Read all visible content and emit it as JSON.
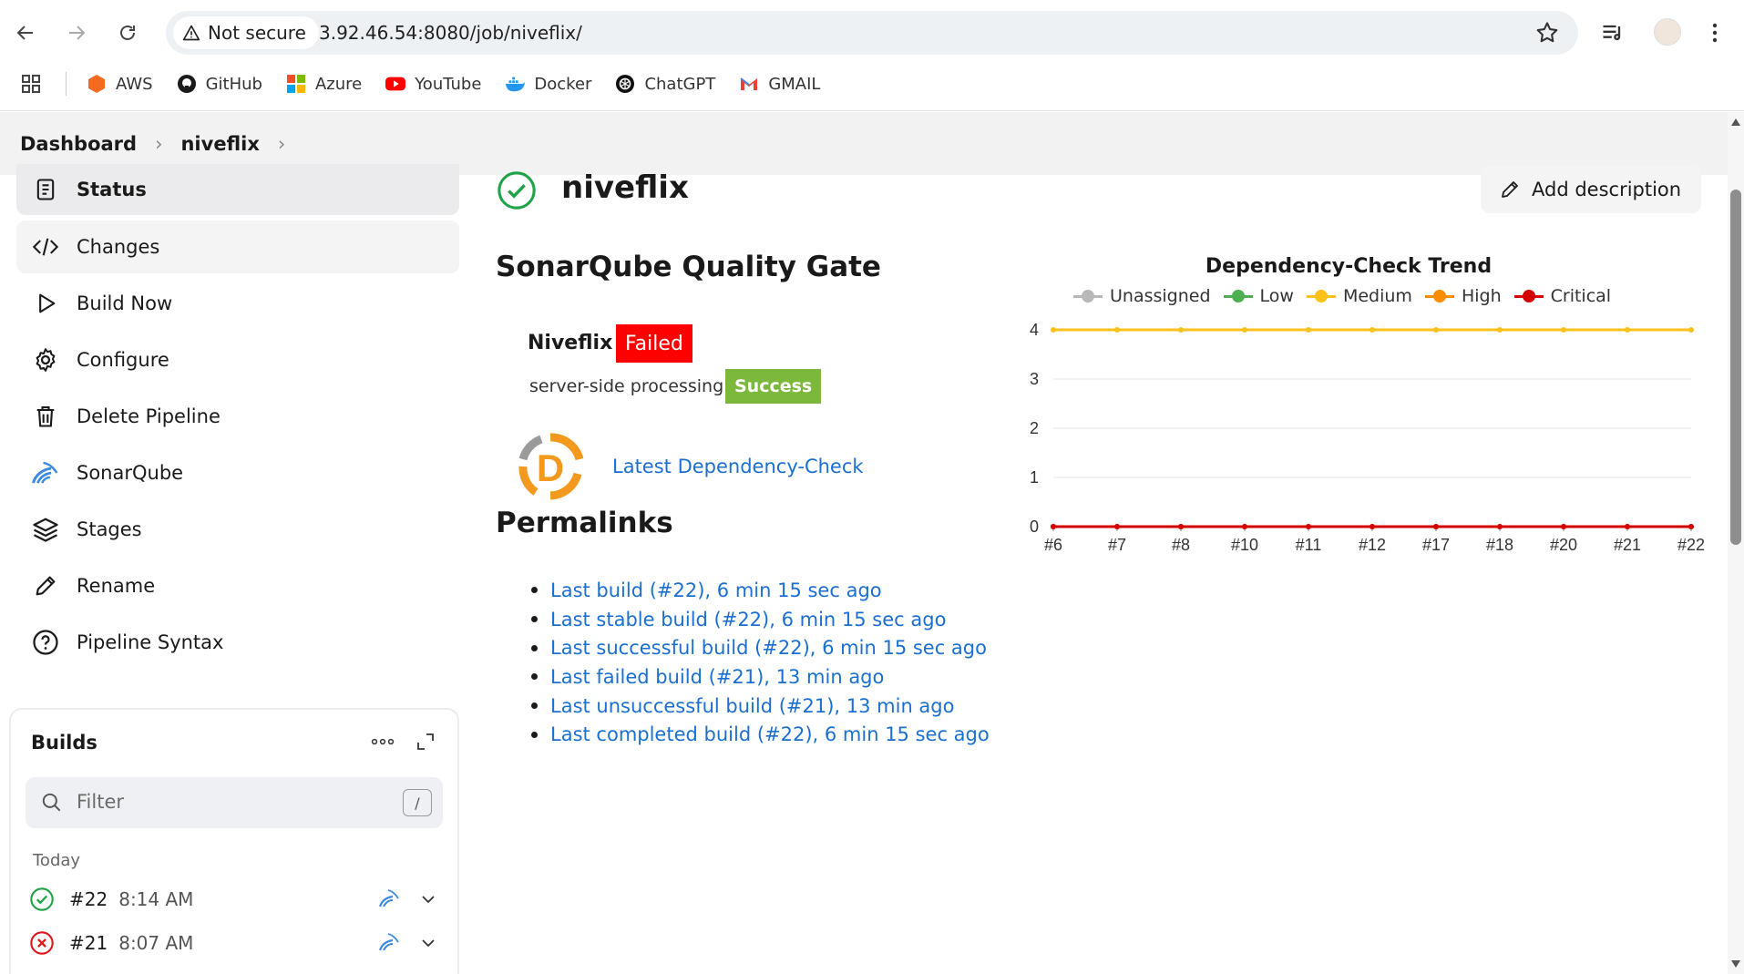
{
  "browser": {
    "security_label": "Not secure",
    "url": "3.92.46.54:8080/job/niveflix/",
    "bookmarks": [
      {
        "label": "AWS",
        "icon": "aws-icon",
        "color": "#f26b21"
      },
      {
        "label": "GitHub",
        "icon": "github-icon",
        "color": "#1a1a1a"
      },
      {
        "label": "Azure",
        "icon": "azure-icon",
        "color": "#0078d4"
      },
      {
        "label": "YouTube",
        "icon": "youtube-icon",
        "color": "#ff0000"
      },
      {
        "label": "Docker",
        "icon": "docker-icon",
        "color": "#2496ed"
      },
      {
        "label": "ChatGPT",
        "icon": "chatgpt-icon",
        "color": "#111111"
      },
      {
        "label": "GMAIL",
        "icon": "gmail-icon",
        "color": "#ea4335"
      }
    ]
  },
  "breadcrumb": {
    "items": [
      "Dashboard",
      "niveflix"
    ]
  },
  "sidebar": {
    "items": [
      {
        "label": "Status",
        "icon": "document-icon"
      },
      {
        "label": "Changes",
        "icon": "code-icon"
      },
      {
        "label": "Build Now",
        "icon": "play-icon"
      },
      {
        "label": "Configure",
        "icon": "gear-icon"
      },
      {
        "label": "Delete Pipeline",
        "icon": "trash-icon"
      },
      {
        "label": "SonarQube",
        "icon": "sonarqube-icon"
      },
      {
        "label": "Stages",
        "icon": "layers-icon"
      },
      {
        "label": "Rename",
        "icon": "pencil-icon"
      },
      {
        "label": "Pipeline Syntax",
        "icon": "help-icon"
      }
    ]
  },
  "builds": {
    "title": "Builds",
    "filter_placeholder": "Filter",
    "shortcut": "/",
    "group_label": "Today",
    "rows": [
      {
        "number": "#22",
        "time": "8:14 AM",
        "status": "success"
      },
      {
        "number": "#21",
        "time": "8:07 AM",
        "status": "failed"
      }
    ]
  },
  "main": {
    "job_title": "niveflix",
    "add_description": "Add description",
    "quality_gate": {
      "heading": "SonarQube Quality Gate",
      "project": "Niveflix",
      "status": "Failed",
      "processing_label": "server-side processing:",
      "processing_status": "Success"
    },
    "dependency_link": "Latest Dependency-Check",
    "permalinks": {
      "heading": "Permalinks",
      "items": [
        "Last build (#22), 6 min 15 sec ago",
        "Last stable build (#22), 6 min 15 sec ago",
        "Last successful build (#22), 6 min 15 sec ago",
        "Last failed build (#21), 13 min ago",
        "Last unsuccessful build (#21), 13 min ago",
        "Last completed build (#22), 6 min 15 sec ago"
      ]
    }
  },
  "chart_data": {
    "type": "line",
    "title": "Dependency-Check Trend",
    "categories": [
      "#6",
      "#7",
      "#8",
      "#10",
      "#11",
      "#12",
      "#17",
      "#18",
      "#20",
      "#21",
      "#22"
    ],
    "ylim": [
      0,
      4
    ],
    "yticks": [
      0,
      1,
      2,
      3,
      4
    ],
    "grid": true,
    "legend_position": "top",
    "series": [
      {
        "name": "Unassigned",
        "color": "#b8b8b8",
        "values": [
          0,
          0,
          0,
          0,
          0,
          0,
          0,
          0,
          0,
          0,
          0
        ]
      },
      {
        "name": "Low",
        "color": "#4caf50",
        "values": [
          0,
          0,
          0,
          0,
          0,
          0,
          0,
          0,
          0,
          0,
          0
        ]
      },
      {
        "name": "Medium",
        "color": "#fbc11b",
        "values": [
          4,
          4,
          4,
          4,
          4,
          4,
          4,
          4,
          4,
          4,
          4
        ]
      },
      {
        "name": "High",
        "color": "#fb8c00",
        "values": [
          0,
          0,
          0,
          0,
          0,
          0,
          0,
          0,
          0,
          0,
          0
        ]
      },
      {
        "name": "Critical",
        "color": "#d50000",
        "values": [
          0,
          0,
          0,
          0,
          0,
          0,
          0,
          0,
          0,
          0,
          0
        ]
      }
    ]
  }
}
